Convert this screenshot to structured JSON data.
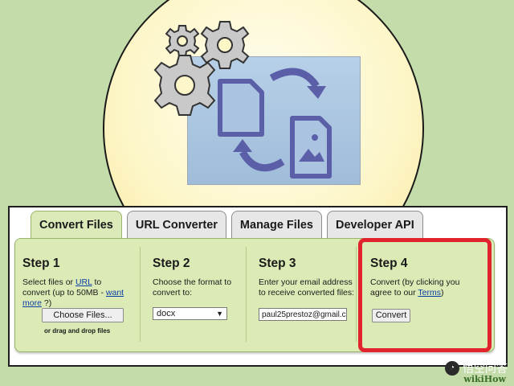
{
  "tabs": [
    {
      "label": "Convert Files",
      "active": true
    },
    {
      "label": "URL Converter",
      "active": false
    },
    {
      "label": "Manage Files",
      "active": false
    },
    {
      "label": "Developer API",
      "active": false
    }
  ],
  "step1": {
    "title": "Step 1",
    "text_pre": "Select files or ",
    "url_link": "URL",
    "text_mid": " to convert (up to 50MB - ",
    "want_more_link": "want more",
    "text_post": " ?)",
    "choose_button": "Choose Files...",
    "drag_hint": "or drag and drop files"
  },
  "step2": {
    "title": "Step 2",
    "text": "Choose the format to convert to:",
    "format_value": "docx"
  },
  "step3": {
    "title": "Step 3",
    "text": "Enter your email address to receive converted files:",
    "email_value": "paul25prestoz@gmail.co"
  },
  "step4": {
    "title": "Step 4",
    "text_pre": "Convert (by clicking you agree to our ",
    "terms_link": "Terms",
    "text_post": ")",
    "convert_button": "Convert"
  },
  "watermark": {
    "text": "悟空问答",
    "brand": "wikiHow"
  },
  "colors": {
    "highlight": "#e0232d",
    "step_bg": "#dcebb6",
    "page_bg": "#c4dca9"
  }
}
